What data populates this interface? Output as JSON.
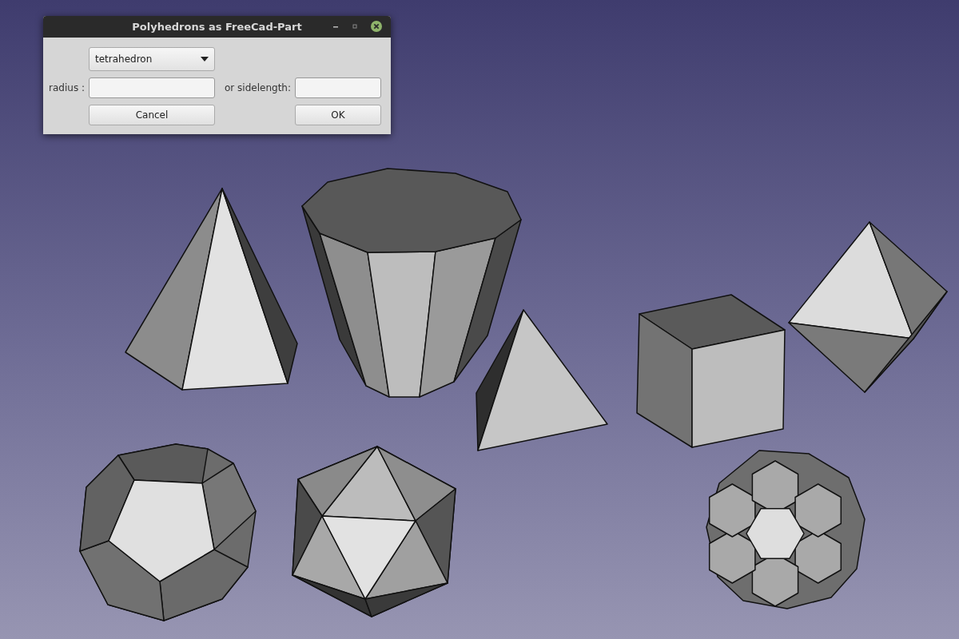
{
  "window": {
    "title": "Polyhedrons as FreeCad-Part"
  },
  "shape_select": {
    "value": "tetrahedron"
  },
  "fields": [
    {
      "label": "radius :"
    },
    {
      "label": "or sidelength:"
    }
  ],
  "buttons": [
    {
      "label": "Cancel"
    },
    {
      "label": "OK"
    }
  ]
}
